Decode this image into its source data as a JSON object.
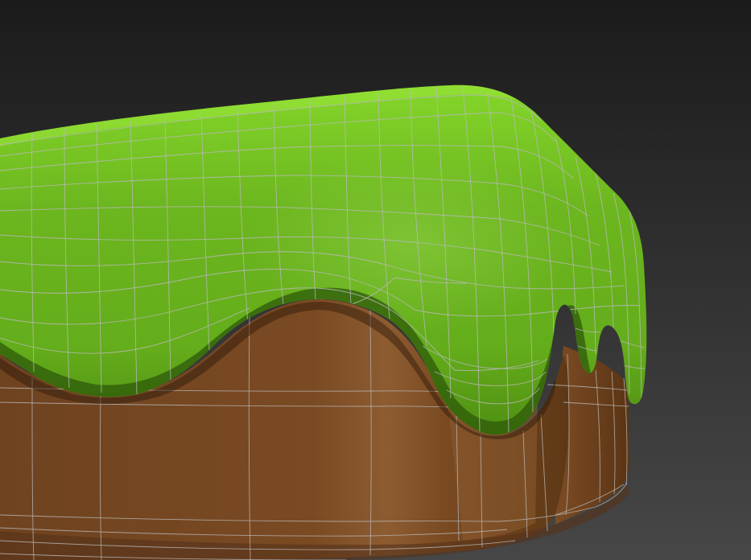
{
  "viewport": {
    "background_top": "#1b1b1b",
    "background_bottom": "#474747",
    "wireframe_color": "#b9b9b9"
  },
  "scene": {
    "objects": [
      {
        "name": "cake-base",
        "material_color": "#7a4a22",
        "highlight_color": "#8a5a30",
        "shadow_color": "#4e2e12"
      },
      {
        "name": "icing-drip",
        "material_color": "#6bb31e",
        "highlight_color": "#84d62a",
        "shadow_color": "#2f5a0a"
      }
    ]
  }
}
